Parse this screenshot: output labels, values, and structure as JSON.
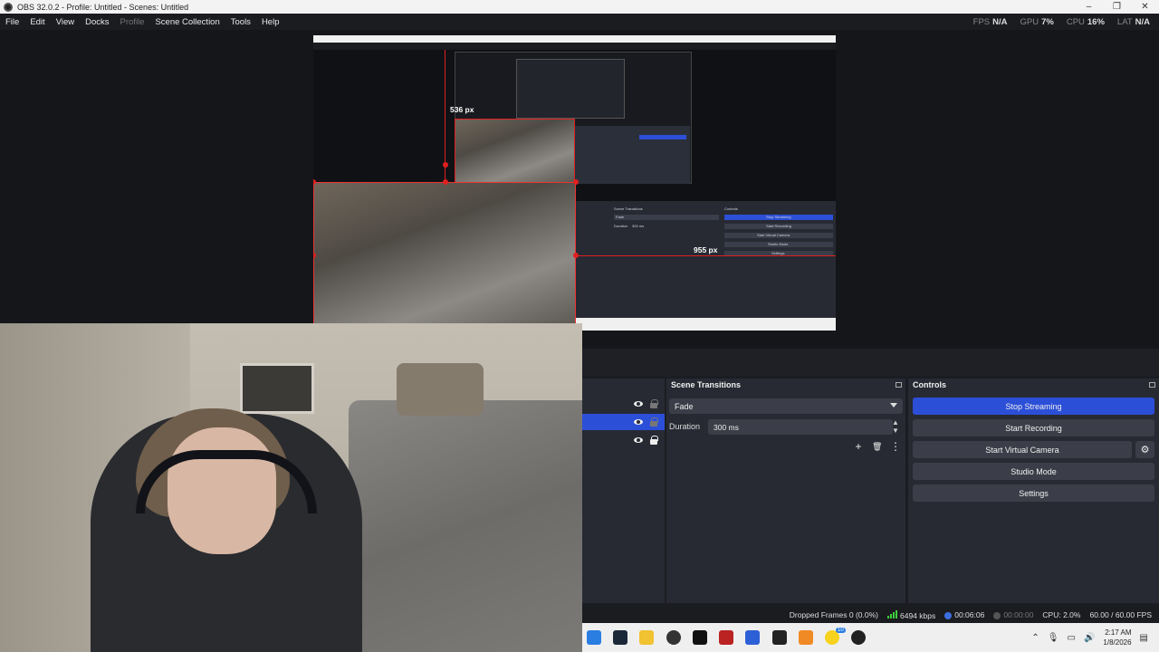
{
  "window": {
    "title": "OBS 32.0.2 - Profile: Untitled - Scenes: Untitled",
    "minimize": "–",
    "maximize": "❐",
    "close": "✕"
  },
  "menu": [
    "File",
    "Edit",
    "View",
    "Docks",
    "Profile",
    "Scene Collection",
    "Tools",
    "Help"
  ],
  "stats": {
    "fps_label": "FPS",
    "fps_value": "N/A",
    "gpu_label": "GPU",
    "gpu_value": "7%",
    "cpu_label": "CPU",
    "cpu_value": "16%",
    "lat_label": "LAT",
    "lat_value": "N/A"
  },
  "preview": {
    "height_label": "536 px",
    "width_label": "955 px",
    "nested": {
      "transitions": "Scene Transitions",
      "controls": "Controls",
      "fade": "Fade",
      "duration": "Duration",
      "duration_value": "300 ms",
      "stop_streaming": "Stop Streaming",
      "start_recording": "Start Recording",
      "start_virtual_camera": "Start Virtual Camera",
      "studio_mode": "Studio Mode",
      "settings": "Settings"
    }
  },
  "transitions": {
    "title": "Scene Transitions",
    "selected": "Fade",
    "duration_label": "Duration",
    "duration_value": "300 ms",
    "add_icon": "+",
    "trash_icon": "🗑",
    "menu_icon": "⋮",
    "spin_up": "▲",
    "spin_down": "▼"
  },
  "controls": {
    "title": "Controls",
    "stop_streaming": "Stop Streaming",
    "start_recording": "Start Recording",
    "start_virtual_camera": "Start Virtual Camera",
    "studio_mode": "Studio Mode",
    "settings": "Settings",
    "gear_icon": "⚙"
  },
  "status": {
    "dropped_frames": "Dropped Frames 0 (0.0%)",
    "bitrate": "6494 kbps",
    "stream_time": "00:06:06",
    "record_time": "00:00:00",
    "cpu": "CPU: 2.0%",
    "fps": "60.00 / 60.00 FPS"
  },
  "taskbar": {
    "time": "2:17 AM",
    "date": "1/8/2026",
    "tray_chevron": "⌃",
    "notification_badge": "10"
  },
  "colors": {
    "accent": "#2c4fd8",
    "guide": "#e02020",
    "signal": "#3fcf3f"
  }
}
